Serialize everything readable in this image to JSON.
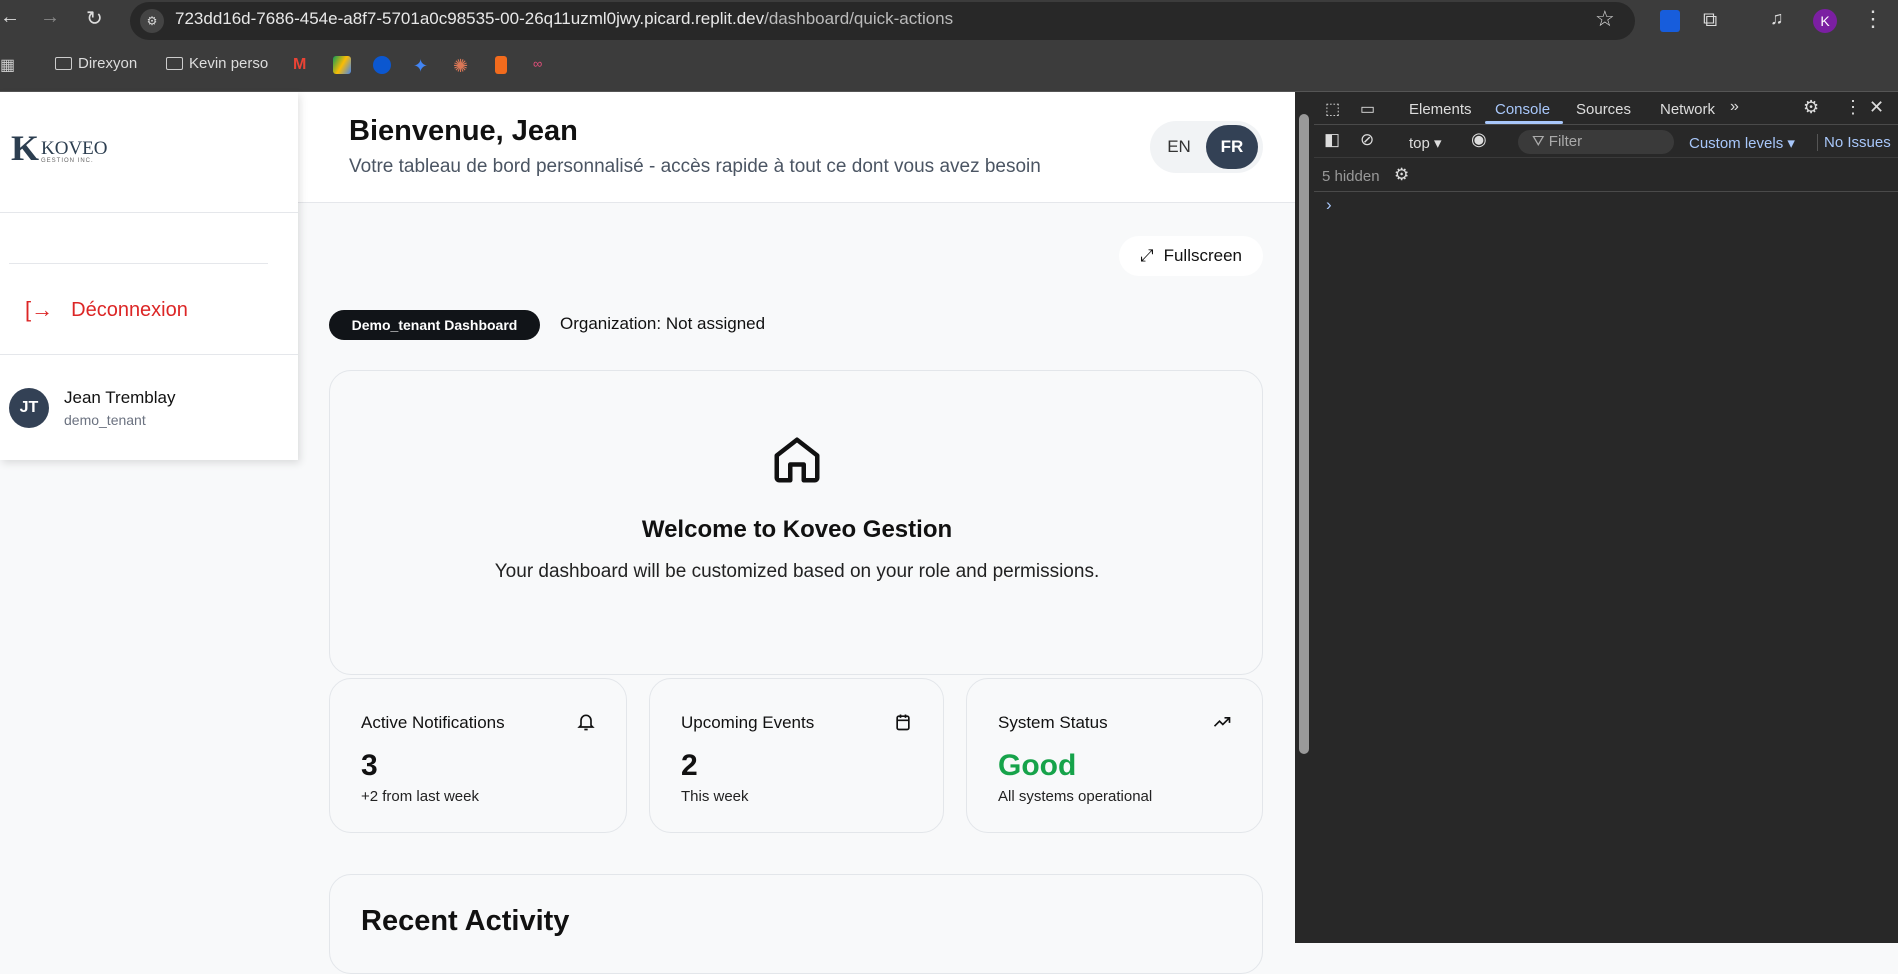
{
  "browser": {
    "url_host": "723dd16d-7686-454e-a8f7-5701a0c98535-00-26q11uzml0jwy.picard.replit.dev",
    "url_path": "/dashboard/quick-actions",
    "profile_initial": "K",
    "bookmarks": [
      "Direxyon",
      "Kevin perso"
    ]
  },
  "sidebar": {
    "logo_text": "KOVEO",
    "logo_sub": "GESTION INC.",
    "logout": "Déconnexion",
    "user_initials": "JT",
    "user_name": "Jean Tremblay",
    "user_role": "demo_tenant"
  },
  "header": {
    "title": "Bienvenue, Jean",
    "subtitle": "Votre tableau de bord personnalisé - accès rapide à tout ce dont vous avez besoin",
    "lang_en": "EN",
    "lang_fr": "FR"
  },
  "main": {
    "fullscreen": "Fullscreen",
    "badge": "Demo_tenant Dashboard",
    "organization": "Organization: Not assigned",
    "welcome_title": "Welcome to Koveo Gestion",
    "welcome_text": "Your dashboard will be customized based on your role and permissions.",
    "stats": [
      {
        "title": "Active Notifications",
        "value": "3",
        "sub": "+2 from last week"
      },
      {
        "title": "Upcoming Events",
        "value": "2",
        "sub": "This week"
      },
      {
        "title": "System Status",
        "value": "Good",
        "sub": "All systems operational"
      }
    ],
    "status_color": "#16a34a",
    "recent_activity": "Recent Activity"
  },
  "devtools": {
    "tabs": [
      "Elements",
      "Console",
      "Sources",
      "Network"
    ],
    "context": "top",
    "filter_placeholder": "Filter",
    "levels": "Custom levels",
    "issues": "No Issues",
    "hidden": "5 hidden",
    "prompt": "›"
  }
}
